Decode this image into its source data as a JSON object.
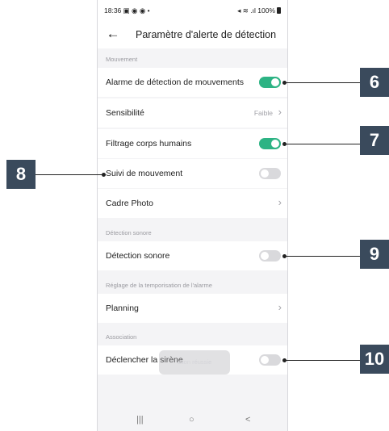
{
  "status_bar": {
    "time": "18:36",
    "icons_left": "▣ ◉ ◉ •",
    "icons_right": "◂ ≋ .ıl 100%"
  },
  "app_bar": {
    "title": "Paramètre d'alerte de détection"
  },
  "sections": {
    "movement": "Mouvement",
    "sound": "Détection sonore",
    "schedule": "Réglage de la temporisation de l'alarme",
    "association": "Association"
  },
  "rows": {
    "motion_alarm": {
      "label": "Alarme de détection de mouvements",
      "on": true
    },
    "sensitivity": {
      "label": "Sensibilité",
      "value": "Faible"
    },
    "human_filter": {
      "label": "Filtrage corps humains",
      "on": true
    },
    "motion_tracking": {
      "label": "Suivi de mouvement",
      "on": false
    },
    "photo_frame": {
      "label": "Cadre Photo"
    },
    "sound_detection": {
      "label": "Détection sonore",
      "on": false
    },
    "planning": {
      "label": "Planning"
    },
    "siren": {
      "label": "Déclencher la sirène",
      "on": false
    }
  },
  "toast": {
    "text": "ation réussie"
  },
  "nav_bar": {
    "recent": "|||",
    "home": "○",
    "back": "<"
  },
  "callouts": {
    "c6": "6",
    "c7": "7",
    "c8": "8",
    "c9": "9",
    "c10": "10"
  },
  "colors": {
    "toggle_on": "#2db384",
    "toggle_off": "#d9d9dc",
    "callout_bg": "#3a4a5c"
  }
}
